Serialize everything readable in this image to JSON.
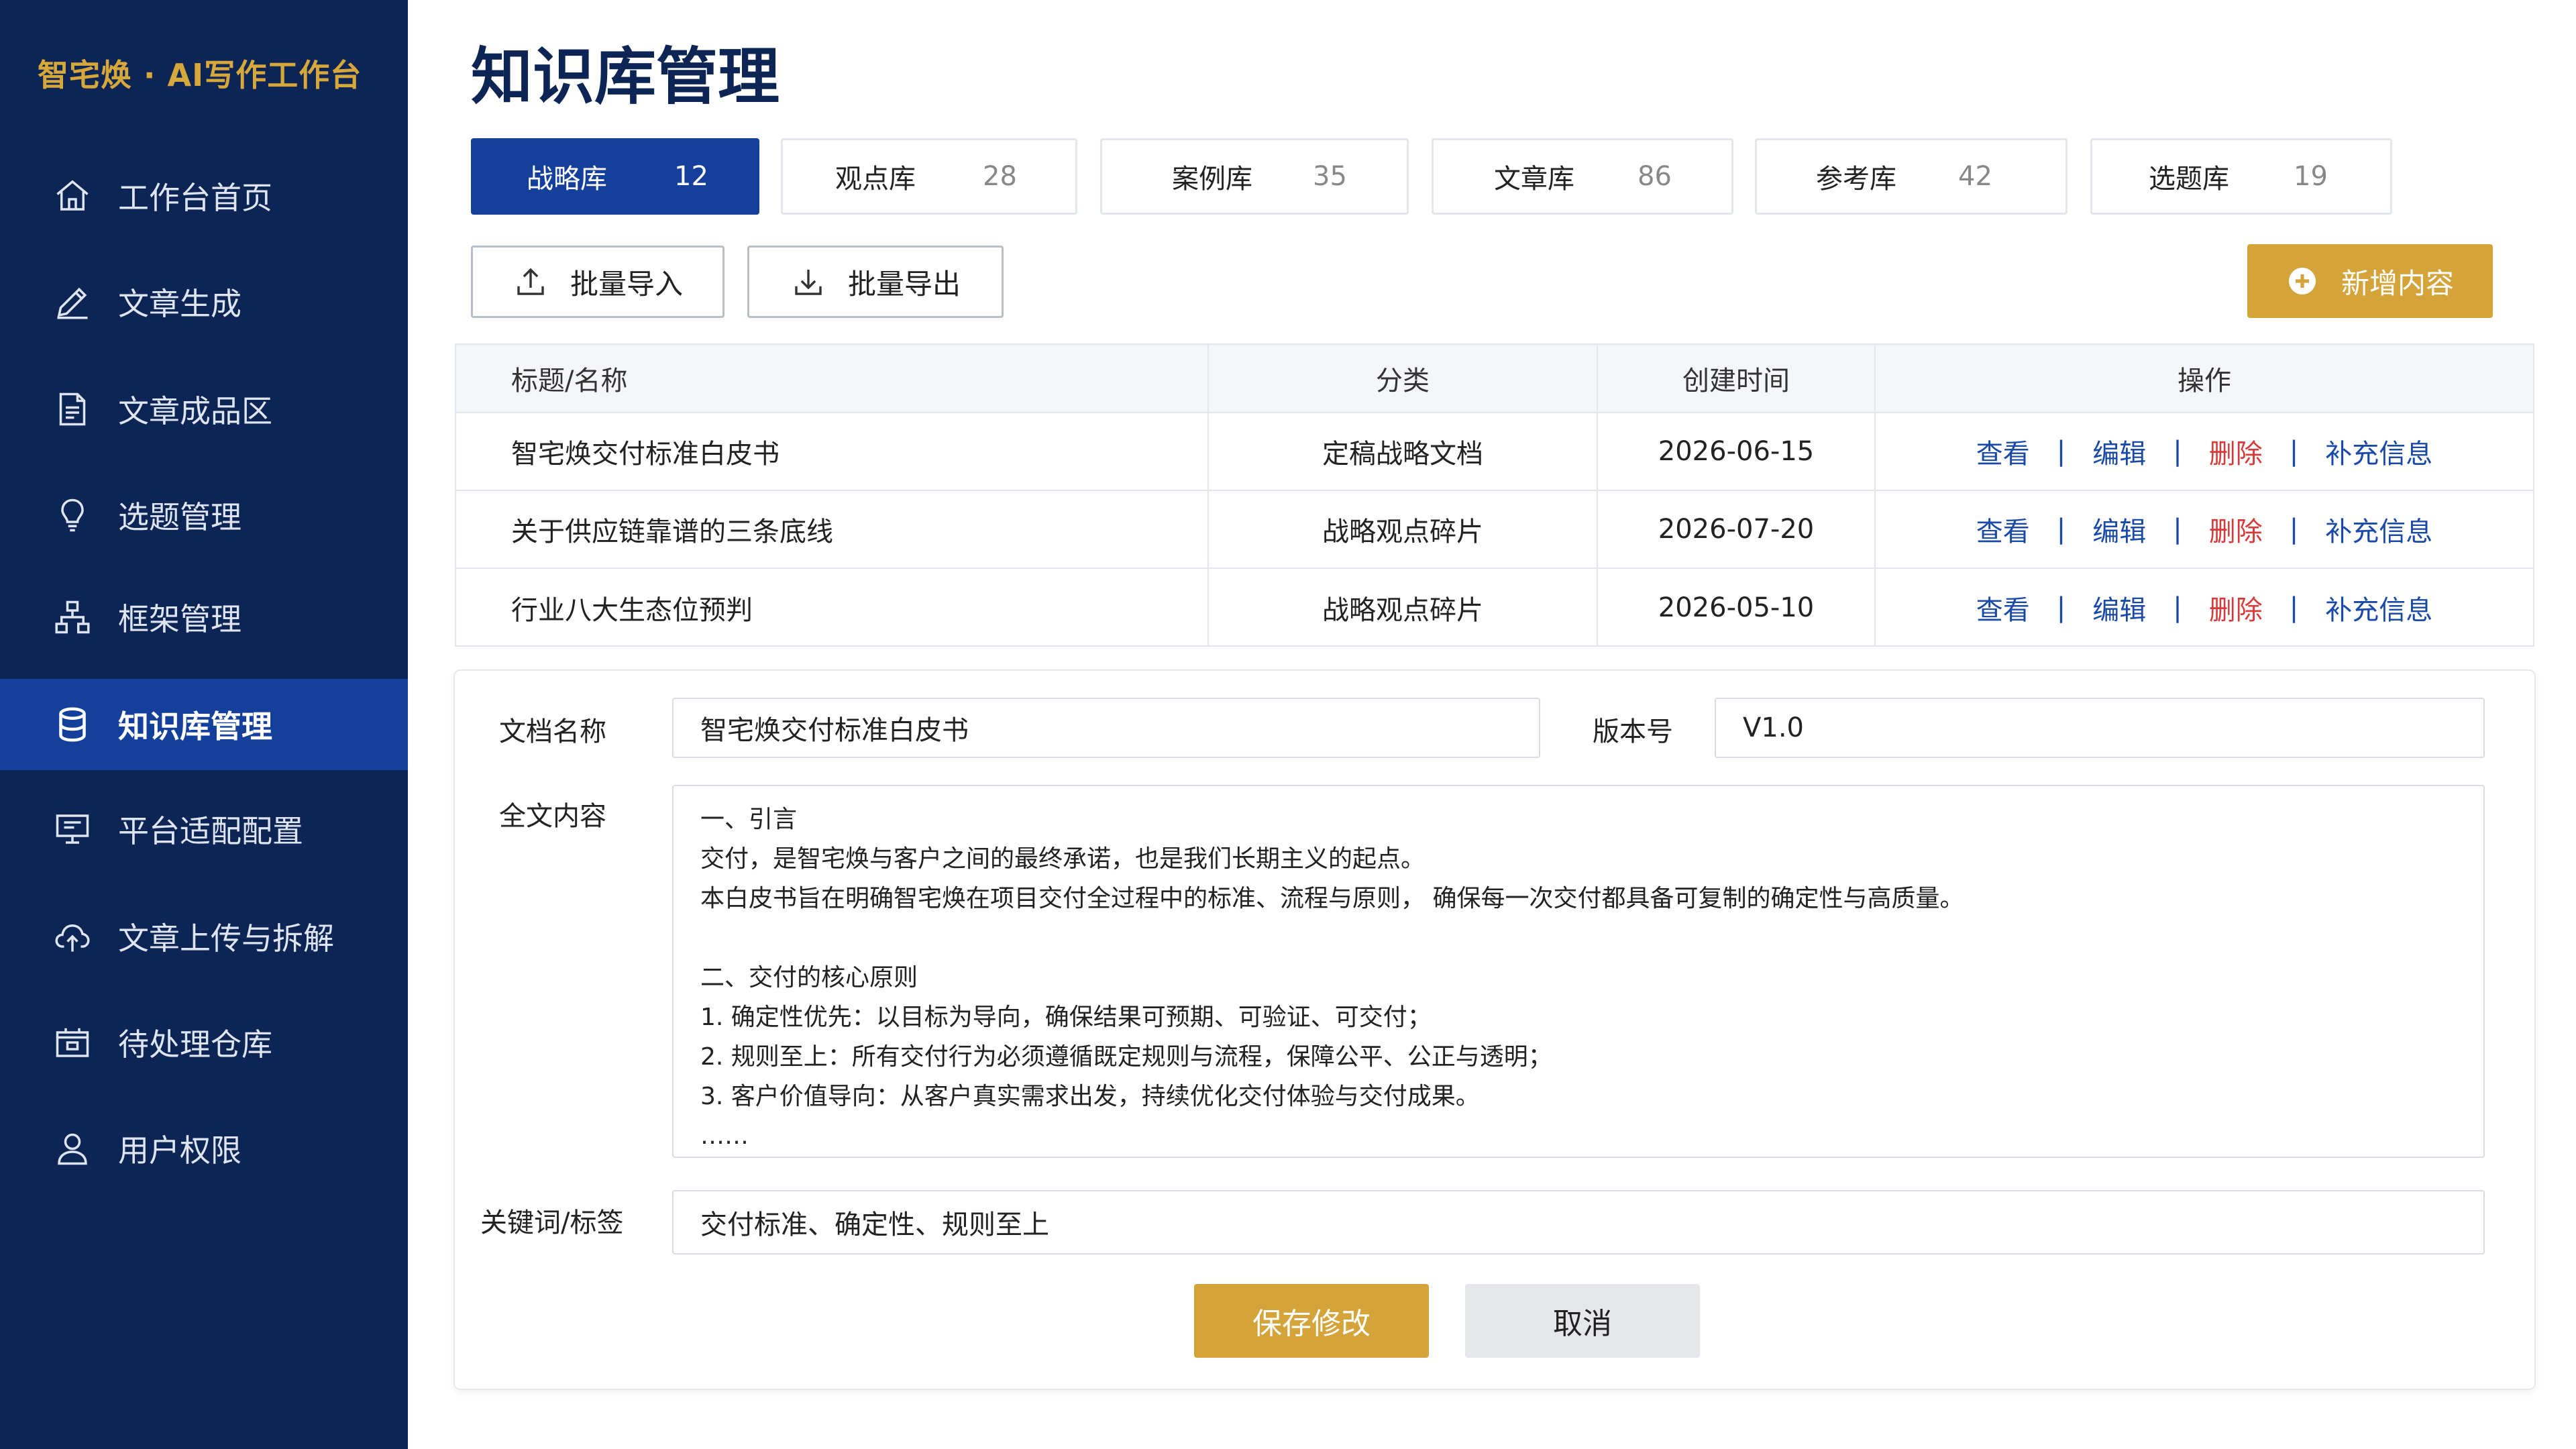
{
  "app": {
    "brand": "智宅焕 · AI写作工作台"
  },
  "sidebar": {
    "items": [
      {
        "label": "工作台首页",
        "icon": "home-icon"
      },
      {
        "label": "文章生成",
        "icon": "pen-icon"
      },
      {
        "label": "文章成品区",
        "icon": "document-icon"
      },
      {
        "label": "选题管理",
        "icon": "lightbulb-icon"
      },
      {
        "label": "框架管理",
        "icon": "hierarchy-icon"
      },
      {
        "label": "知识库管理",
        "icon": "database-icon",
        "active": true
      },
      {
        "label": "平台适配配置",
        "icon": "monitor-icon"
      },
      {
        "label": "文章上传与拆解",
        "icon": "cloud-upload-icon"
      },
      {
        "label": "待处理仓库",
        "icon": "inbox-icon"
      },
      {
        "label": "用户权限",
        "icon": "user-icon"
      }
    ]
  },
  "page": {
    "title": "知识库管理"
  },
  "tabs": [
    {
      "label": "战略库",
      "count": "12",
      "active": true
    },
    {
      "label": "观点库",
      "count": "28"
    },
    {
      "label": "案例库",
      "count": "35"
    },
    {
      "label": "文章库",
      "count": "86"
    },
    {
      "label": "参考库",
      "count": "42"
    },
    {
      "label": "选题库",
      "count": "19"
    }
  ],
  "toolbar": {
    "import_label": "批量导入",
    "export_label": "批量导出",
    "add_label": "新增内容"
  },
  "table": {
    "headers": [
      "标题/名称",
      "分类",
      "创建时间",
      "操作"
    ],
    "actions": [
      "查看",
      "编辑",
      "删除",
      "补充信息"
    ],
    "separator": "|",
    "rows": [
      {
        "title": "智宅焕交付标准白皮书",
        "category": "定稿战略文档",
        "date": "2026-06-15"
      },
      {
        "title": "关于供应链靠谱的三条底线",
        "category": "战略观点碎片",
        "date": "2026-07-20"
      },
      {
        "title": "行业八大生态位预判",
        "category": "战略观点碎片",
        "date": "2026-05-10"
      }
    ]
  },
  "detail": {
    "name_label": "文档名称",
    "name_value": "智宅焕交付标准白皮书",
    "version_label": "版本号",
    "version_value": "V1.0",
    "content_label": "全文内容",
    "content_lines": [
      "一、引言",
      "交付，是智宅焕与客户之间的最终承诺，也是我们长期主义的起点。",
      "本白皮书旨在明确智宅焕在项目交付全过程中的标准、流程与原则， 确保每一次交付都具备可复制的确定性与高质量。",
      "",
      "二、交付的核心原则",
      "1. 确定性优先：以目标为导向，确保结果可预期、可验证、可交付；",
      "2. 规则至上：所有交付行为必须遵循既定规则与流程，保障公平、公正与透明；",
      "3. 客户价值导向：从客户真实需求出发，持续优化交付体验与交付成果。",
      "……"
    ],
    "keywords_label": "关键词/标签",
    "keywords_value": "交付标准、确定性、规则至上",
    "save_label": "保存修改",
    "cancel_label": "取消"
  },
  "colors": {
    "sidebar_bg": "#0d2555",
    "sidebar_active": "#14409c",
    "brand_gold": "#d6a73a",
    "accent_gold": "#d4a43a",
    "link_blue": "#1a4aa8",
    "danger_red": "#d83a3a"
  }
}
